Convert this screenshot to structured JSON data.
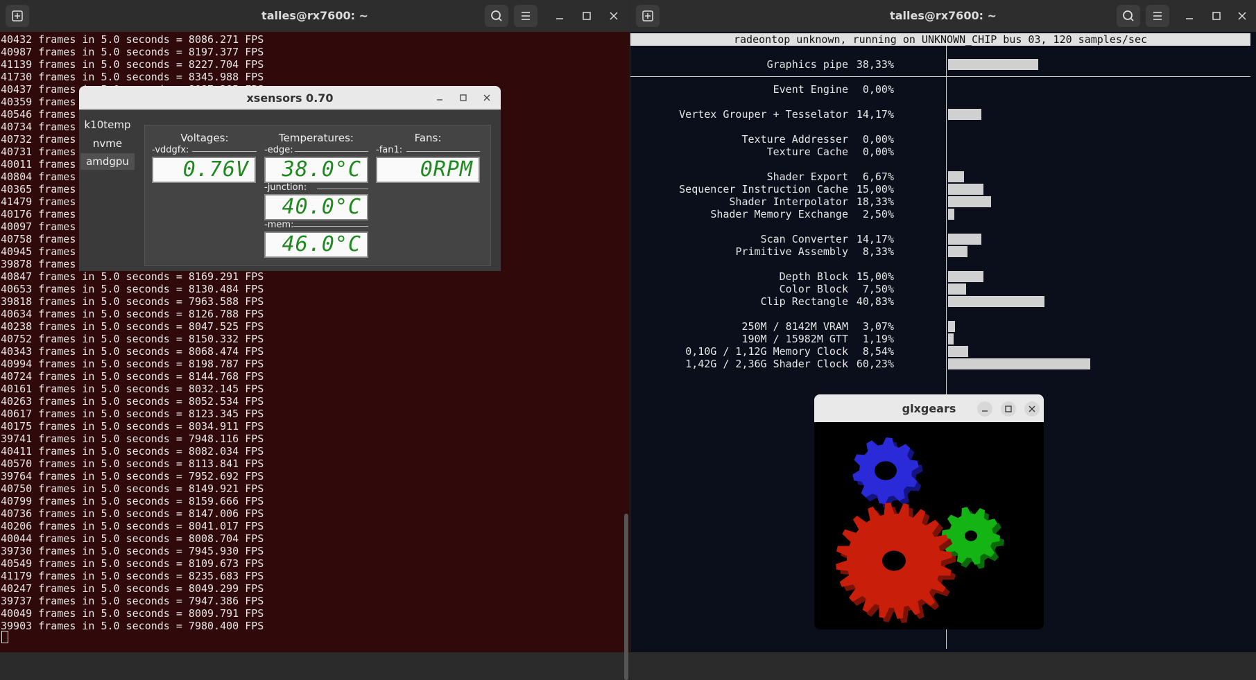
{
  "left_terminal": {
    "title": "talles@rx7600: ~",
    "lines": [
      "40432 frames in 5.0 seconds = 8086.271 FPS",
      "40987 frames in 5.0 seconds = 8197.377 FPS",
      "41139 frames in 5.0 seconds = 8227.704 FPS",
      "41730 frames in 5.0 seconds = 8345.988 FPS",
      "40437 frames in 5.0 seconds = 8087.385 FPS",
      "40359 frames",
      "40546 frames",
      "40734 frames",
      "40732 frames",
      "40731 frames",
      "40011 frames",
      "40804 frames",
      "40365 frames",
      "41479 frames",
      "40176 frames",
      "40097 frames",
      "40758 frames",
      "40945 frames",
      "39878 frames",
      "40847 frames in 5.0 seconds = 8169.291 FPS",
      "40653 frames in 5.0 seconds = 8130.484 FPS",
      "39818 frames in 5.0 seconds = 7963.588 FPS",
      "40634 frames in 5.0 seconds = 8126.788 FPS",
      "40238 frames in 5.0 seconds = 8047.525 FPS",
      "40752 frames in 5.0 seconds = 8150.332 FPS",
      "40343 frames in 5.0 seconds = 8068.474 FPS",
      "40994 frames in 5.0 seconds = 8198.787 FPS",
      "40724 frames in 5.0 seconds = 8144.768 FPS",
      "40161 frames in 5.0 seconds = 8032.145 FPS",
      "40263 frames in 5.0 seconds = 8052.534 FPS",
      "40617 frames in 5.0 seconds = 8123.345 FPS",
      "40175 frames in 5.0 seconds = 8034.911 FPS",
      "39741 frames in 5.0 seconds = 7948.116 FPS",
      "40411 frames in 5.0 seconds = 8082.034 FPS",
      "40570 frames in 5.0 seconds = 8113.841 FPS",
      "39764 frames in 5.0 seconds = 7952.692 FPS",
      "40750 frames in 5.0 seconds = 8149.921 FPS",
      "40799 frames in 5.0 seconds = 8159.666 FPS",
      "40736 frames in 5.0 seconds = 8147.006 FPS",
      "40206 frames in 5.0 seconds = 8041.017 FPS",
      "40044 frames in 5.0 seconds = 8008.704 FPS",
      "39730 frames in 5.0 seconds = 7945.930 FPS",
      "40549 frames in 5.0 seconds = 8109.673 FPS",
      "41179 frames in 5.0 seconds = 8235.683 FPS",
      "40247 frames in 5.0 seconds = 8049.299 FPS",
      "39737 frames in 5.0 seconds = 7947.386 FPS",
      "40049 frames in 5.0 seconds = 8009.791 FPS",
      "39903 frames in 5.0 seconds = 7980.400 FPS"
    ]
  },
  "right_terminal": {
    "title": "talles@rx7600: ~",
    "header": "radeontop unknown, running on UNKNOWN_CHIP bus 03, 120 samples/sec",
    "rows": [
      {
        "label": "Graphics pipe",
        "pct": "38,33%",
        "value": 38.33,
        "line": 0
      },
      {
        "label": "Event Engine",
        "pct": "0,00%",
        "value": 0.0,
        "line": 2
      },
      {
        "label": "Vertex Grouper + Tesselator",
        "pct": "14,17%",
        "value": 14.17,
        "line": 4
      },
      {
        "label": "Texture Addresser",
        "pct": "0,00%",
        "value": 0.0,
        "line": 6
      },
      {
        "label": "Texture Cache",
        "pct": "0,00%",
        "value": 0.0,
        "line": 7
      },
      {
        "label": "Shader Export",
        "pct": "6,67%",
        "value": 6.67,
        "line": 9
      },
      {
        "label": "Sequencer Instruction Cache",
        "pct": "15,00%",
        "value": 15.0,
        "line": 10
      },
      {
        "label": "Shader Interpolator",
        "pct": "18,33%",
        "value": 18.33,
        "line": 11
      },
      {
        "label": "Shader Memory Exchange",
        "pct": "2,50%",
        "value": 2.5,
        "line": 12
      },
      {
        "label": "Scan Converter",
        "pct": "14,17%",
        "value": 14.17,
        "line": 14
      },
      {
        "label": "Primitive Assembly",
        "pct": "8,33%",
        "value": 8.33,
        "line": 15
      },
      {
        "label": "Depth Block",
        "pct": "15,00%",
        "value": 15.0,
        "line": 17
      },
      {
        "label": "Color Block",
        "pct": "7,50%",
        "value": 7.5,
        "line": 18
      },
      {
        "label": "Clip Rectangle",
        "pct": "40,83%",
        "value": 40.83,
        "line": 19
      },
      {
        "label": "250M / 8142M VRAM",
        "pct": "3,07%",
        "value": 3.07,
        "line": 21
      },
      {
        "label": "190M / 15982M GTT",
        "pct": "1,19%",
        "value": 1.19,
        "line": 22
      },
      {
        "label": "0,10G / 1,12G Memory Clock",
        "pct": "8,54%",
        "value": 8.54,
        "line": 23
      },
      {
        "label": "1,42G / 2,36G Shader Clock",
        "pct": "60,23%",
        "value": 60.23,
        "line": 24
      }
    ]
  },
  "xsensors": {
    "title": "xsensors 0.70",
    "tabs": [
      "k10temp",
      "nvme",
      "amdgpu"
    ],
    "active_tab": "amdgpu",
    "voltages_title": "Voltages:",
    "temperatures_title": "Temperatures:",
    "fans_title": "Fans:",
    "vddgfx_label": "-vddgfx:",
    "vddgfx_value": "0.76V",
    "edge_label": "-edge:",
    "edge_value": "38.0°C",
    "junction_label": "-junction:",
    "junction_value": "40.0°C",
    "mem_label": "-mem:",
    "mem_value": "46.0°C",
    "fan1_label": "-fan1:",
    "fan1_value": "0RPM"
  },
  "glxgears": {
    "title": "glxgears"
  },
  "colors": {
    "left_term_bg": "#300a0a",
    "right_term_bg": "#0b0f1c",
    "lcd_text": "#1e8a1e",
    "gear_red": "#c81e0a",
    "gear_green": "#14b414",
    "gear_blue": "#2a2ad8"
  },
  "icons": {
    "new_tab": "new-tab-icon",
    "search": "search-icon",
    "menu": "hamburger-menu-icon",
    "minimize": "minimize-icon",
    "maximize": "maximize-icon",
    "close": "close-icon"
  }
}
